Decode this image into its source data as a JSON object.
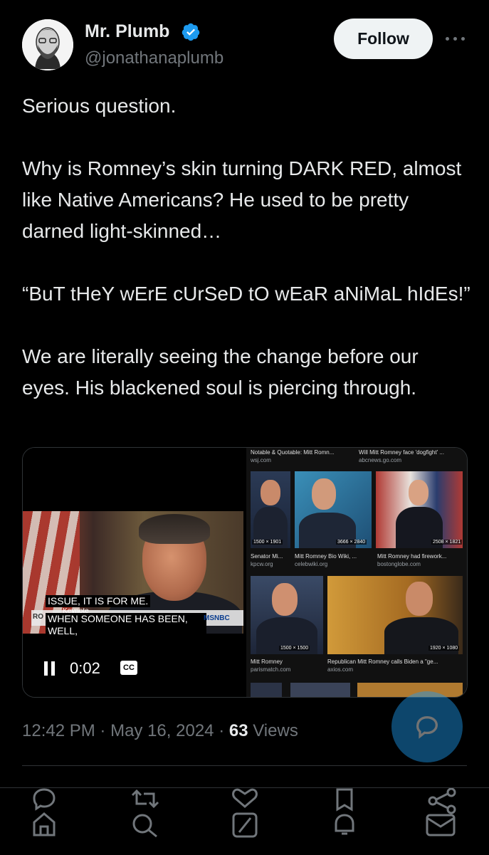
{
  "author": {
    "name": "Mr. Plumb",
    "handle": "@jonathanaplumb",
    "verified": true,
    "follow_label": "Follow"
  },
  "tweet": {
    "text": "Serious question.\n\nWhy is Romney’s skin turning DARK RED, almost like Native Americans? He used to be pretty darned light-skinned…\n\n“BuT tHeY wErE cUrSeD tO wEaR aNiMaL hIdEs!”\n\nWe are literally seeing the change before our eyes. His blackened soul is piercing through."
  },
  "video": {
    "caption_line1": "ISSUE, IT IS FOR ME.",
    "caption_line2": "WHEN SOMEONE HAS BEEN,",
    "caption_line3": "WELL,",
    "keynote_label": "Keynote",
    "ro_label": "RO",
    "network": "MSNBC",
    "time": "0:02",
    "cc_label": "CC"
  },
  "image_results": {
    "top_left_title": "Notable & Quotable: Mitt Romn...",
    "top_left_src": "wsj.com",
    "top_right_title": "Will Mitt Romney face 'dogfight' ...",
    "top_right_src": "abcnews.go.com",
    "row1": [
      {
        "dims": "1500 × 1901",
        "title": "Senator Mi...",
        "src": "kpcw.org"
      },
      {
        "dims": "3666 × 2840",
        "title": "Mitt Romney Bio Wiki, ...",
        "src": "celebwiki.org"
      },
      {
        "dims": "2508 × 1821",
        "title": "Mitt Romney had firework...",
        "src": "bostonglobe.com"
      }
    ],
    "row2": [
      {
        "dims": "1500 × 1500",
        "title": "Mitt Romney",
        "src": "parismatch.com"
      },
      {
        "dims": "1920 × 1080",
        "title": "Republican Mitt Romney calls Biden a \"ge...",
        "src": "axios.com"
      }
    ]
  },
  "meta": {
    "time": "12:42 PM",
    "separator": "·",
    "date": "May 16, 2024",
    "views_count": "63",
    "views_label": "Views"
  },
  "colors": {
    "background": "#000000",
    "text": "#e7e9ea",
    "muted": "#71767b",
    "accent": "#1d9bf0"
  }
}
